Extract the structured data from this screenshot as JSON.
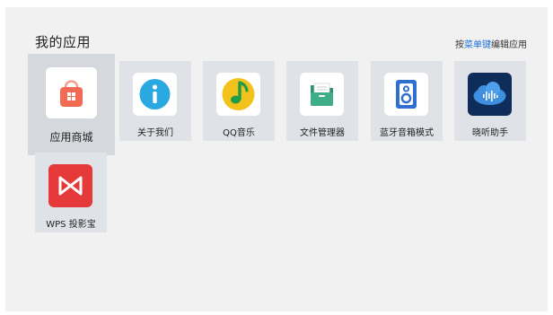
{
  "header": {
    "title": "我的应用",
    "hint_prefix": "按",
    "hint_accent": "菜单键",
    "hint_suffix": "编辑应用"
  },
  "apps": [
    {
      "label": "应用商城",
      "icon": "app-store-bag-icon",
      "color": "#f26b52"
    },
    {
      "label": "关于我们",
      "icon": "info-icon",
      "color": "#2aa8e0"
    },
    {
      "label": "QQ音乐",
      "icon": "music-note-icon",
      "color": "#f2c21a"
    },
    {
      "label": "文件管理器",
      "icon": "folder-icon",
      "color": "#3dae87"
    },
    {
      "label": "蓝牙音箱模式",
      "icon": "speaker-icon",
      "color": "#2f6fd0"
    },
    {
      "label": "晓听助手",
      "icon": "voice-assistant-cloud-icon",
      "color": "#3f8fe0"
    },
    {
      "label": "WPS 投影宝",
      "icon": "wps-projection-icon",
      "color": "#e63a3a"
    }
  ],
  "colors": {
    "accent": "#1a6fd9",
    "background": "#f1f1f1",
    "tile": "#dfe2e6"
  }
}
